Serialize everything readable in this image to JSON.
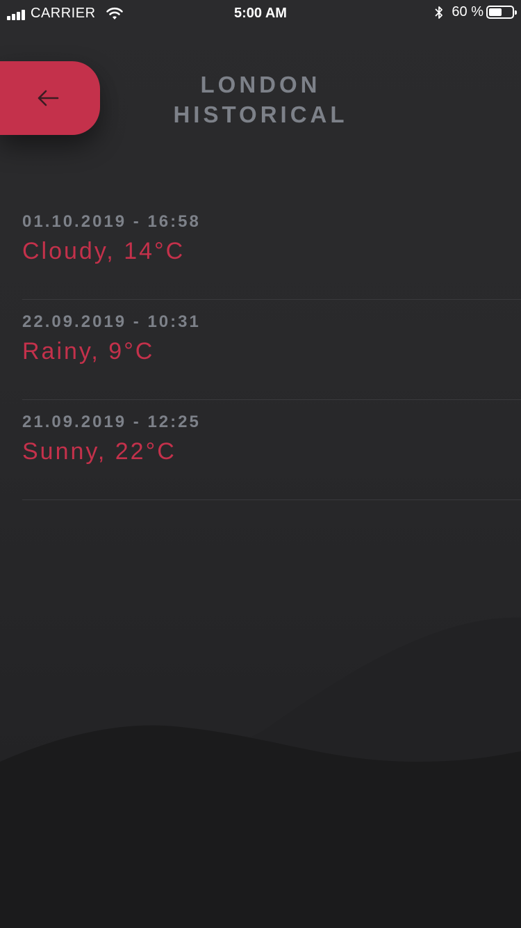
{
  "status_bar": {
    "carrier": "CARRIER",
    "time": "5:00 AM",
    "battery_percent": "60 %",
    "battery_level": 0.6,
    "icons": [
      "signal-icon",
      "wifi-icon",
      "bluetooth-icon",
      "battery-icon"
    ]
  },
  "header": {
    "back_icon": "arrow-left-icon",
    "title_line1": "LONDON",
    "title_line2": "HISTORICAL"
  },
  "history": [
    {
      "date": "01.10.2019 - 16:58",
      "weather": "Cloudy, 14°C"
    },
    {
      "date": "22.09.2019 - 10:31",
      "weather": "Rainy, 9°C"
    },
    {
      "date": "21.09.2019 - 12:25",
      "weather": "Sunny, 22°C"
    }
  ],
  "colors": {
    "background": "#29292b",
    "accent": "#c4314b",
    "muted_text": "#7d8189",
    "divider": "#3a3a3d"
  }
}
